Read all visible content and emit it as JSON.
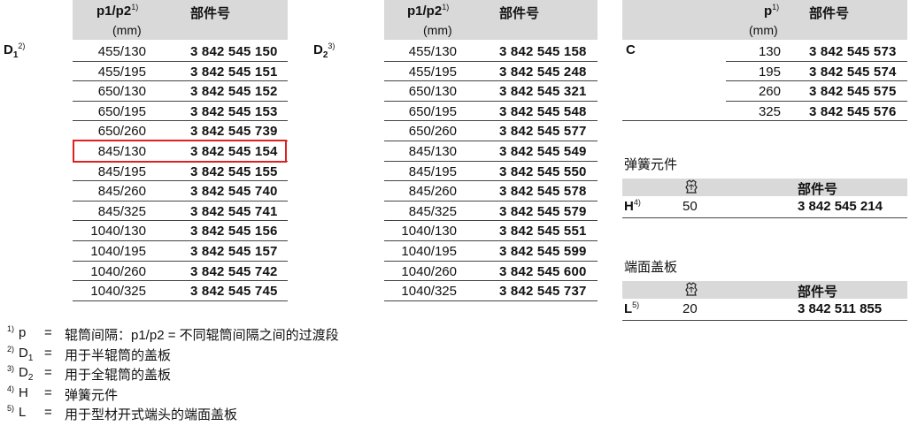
{
  "header": {
    "p_label": "p1/p2",
    "p_sup": "1)",
    "unit": "(mm)",
    "part_label": "部件号"
  },
  "table1": {
    "label": "D",
    "label_sub": "1",
    "label_sup": "2)",
    "rows": [
      {
        "p": "455/130",
        "n": "3 842 545 150"
      },
      {
        "p": "455/195",
        "n": "3 842 545 151"
      },
      {
        "p": "650/130",
        "n": "3 842 545 152"
      },
      {
        "p": "650/195",
        "n": "3 842 545 153"
      },
      {
        "p": "650/260",
        "n": "3 842 545 739"
      },
      {
        "p": "845/130",
        "n": "3 842 545 154"
      },
      {
        "p": "845/195",
        "n": "3 842 545 155"
      },
      {
        "p": "845/260",
        "n": "3 842 545 740"
      },
      {
        "p": "845/325",
        "n": "3 842 545 741"
      },
      {
        "p": "1040/130",
        "n": "3 842 545 156"
      },
      {
        "p": "1040/195",
        "n": "3 842 545 157"
      },
      {
        "p": "1040/260",
        "n": "3 842 545 742"
      },
      {
        "p": "1040/325",
        "n": "3 842 545 745"
      }
    ]
  },
  "table2": {
    "label": "D",
    "label_sub": "2",
    "label_sup": "3)",
    "rows": [
      {
        "p": "455/130",
        "n": "3 842 545 158"
      },
      {
        "p": "455/195",
        "n": "3 842 545 248"
      },
      {
        "p": "650/130",
        "n": "3 842 545 321"
      },
      {
        "p": "650/195",
        "n": "3 842 545 548"
      },
      {
        "p": "650/260",
        "n": "3 842 545 577"
      },
      {
        "p": "845/130",
        "n": "3 842 545 549"
      },
      {
        "p": "845/195",
        "n": "3 842 545 550"
      },
      {
        "p": "845/260",
        "n": "3 842 545 578"
      },
      {
        "p": "845/325",
        "n": "3 842 545 579"
      },
      {
        "p": "1040/130",
        "n": "3 842 545 551"
      },
      {
        "p": "1040/195",
        "n": "3 842 545 599"
      },
      {
        "p": "1040/260",
        "n": "3 842 545 600"
      },
      {
        "p": "1040/325",
        "n": "3 842 545 737"
      }
    ]
  },
  "table3": {
    "p_label": "p",
    "p_sup": "1)",
    "unit": "(mm)",
    "part_label": "部件号",
    "label": "C",
    "rows": [
      {
        "p": "130",
        "n": "3 842 545 573"
      },
      {
        "p": "195",
        "n": "3 842 545 574"
      },
      {
        "p": "260",
        "n": "3 842 545 575"
      },
      {
        "p": "325",
        "n": "3 842 545 576"
      }
    ]
  },
  "spring": {
    "title": "弹簧元件",
    "part_label": "部件号",
    "label": "H",
    "label_sup": "4)",
    "qty": "50",
    "n": "3 842 545 214"
  },
  "endcap": {
    "title": "端面盖板",
    "part_label": "部件号",
    "label": "L",
    "label_sup": "5)",
    "qty": "20",
    "n": "3 842 511 855"
  },
  "footnotes": [
    {
      "sup": "1)",
      "sym": "p",
      "sub": "",
      "text": "辊筒间隔：p1/p2 = 不同辊筒间隔之间的过渡段"
    },
    {
      "sup": "2)",
      "sym": "D",
      "sub": "1",
      "text": "用于半辊筒的盖板"
    },
    {
      "sup": "3)",
      "sym": "D",
      "sub": "2",
      "text": "用于全辊筒的盖板"
    },
    {
      "sup": "4)",
      "sym": "H",
      "sub": "",
      "text": "弹簧元件"
    },
    {
      "sup": "5)",
      "sym": "L",
      "sub": "",
      "text": "用于型材开式端头的端面盖板"
    }
  ],
  "eq": "=",
  "highlight_color": "#e02020"
}
